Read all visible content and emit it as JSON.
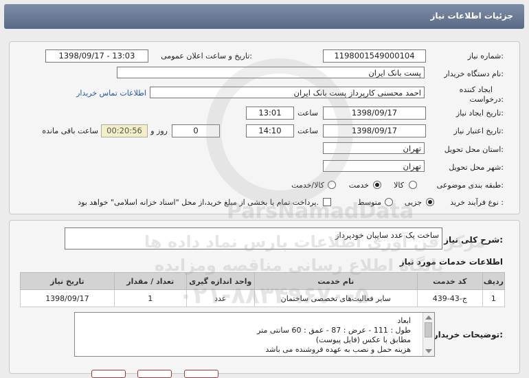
{
  "title": "جزئیات اطلاعات نیاز",
  "fields": {
    "need_number_label": "شماره نیاز:",
    "need_number": "1198001549000104",
    "announce_label": "تاریخ و ساعت اعلان عمومی:",
    "announce_value": "1398/09/17 - 13:03",
    "buyer_label": "نام دستگاه خریدار:",
    "buyer_value": "پست بانک ایران",
    "creator_label_1": "ایجاد کننده",
    "creator_label_2": "درخواست:",
    "creator_value": "احمد  محسنی کارپرداز پست بانک ایران",
    "contact_link": "اطلاعات تماس خریدار",
    "created_date_label": "تاریخ ایجاد نیاز:",
    "created_date": "1398/09/17",
    "created_time_label": "ساعت",
    "created_time": "13:01",
    "validity_label": "تاریخ اعتبار نیاز:",
    "validity_date": "1398/09/17",
    "validity_time_label": "ساعت",
    "validity_time": "14:10",
    "days_value": "0",
    "days_label": "روز و",
    "remaining_time": "00:20:56",
    "remaining_label": "ساعت باقی مانده",
    "province_label": "استان محل تحویل:",
    "province_value": "تهران",
    "city_label": "شهر محل تحویل:",
    "city_value": "تهران",
    "category_label": "طبقه بندی موضوعی:",
    "category_options": [
      "کالا",
      "خدمت",
      "کالا/خدمت"
    ],
    "category_selected": "خدمت",
    "process_label": "نوع فرآیند خرید :",
    "process_options": [
      "جزیی",
      "متوسط"
    ],
    "process_selected": "جزیی",
    "payment_note": "پرداخت تمام یا بخشی از مبلغ خرید،از محل \"اسناد خزانه اسلامی\" خواهد بود."
  },
  "summary": {
    "label": "شرح کلی نیاز:",
    "value": "ساخت یک عدد سایبان خودپرداز"
  },
  "services": {
    "section_title": "اطلاعات خدمات مورد نیاز",
    "columns": [
      "ردیف",
      "کد خدمت",
      "نام خدمت",
      "واحد اندازه گیری",
      "تعداد / مقدار",
      "تاریخ نیاز"
    ],
    "rows": [
      [
        "1",
        "ج-43-439",
        "سایر فعالیت‌های تخصصی ساختمان",
        "عدد",
        "1",
        "1398/09/17"
      ]
    ]
  },
  "notes": {
    "label": "توضیحات خریدار:",
    "lines": [
      "ابعاد",
      "طول :  111   - عرض :  87   - عمق :  60 سانتی متر",
      "مطابق با عکس (فایل پیوست)",
      "هزینه حمل و نصب به عهده فروشنده می باشد"
    ]
  },
  "watermark": {
    "brand": "ParsNamadData",
    "fa_1": "مرکز فن آوری اطلاعات پارس نماد داده ها",
    "fa_2": "پایگاه اطلاع رسانی مناقصه ومزایده",
    "phone": "۰۲۱-۸۸۳۴۹۶۷۰-۵"
  },
  "colors": {
    "header": "#5a6a86",
    "link": "#2255aa",
    "remaining_bg": "#f3efc6"
  }
}
